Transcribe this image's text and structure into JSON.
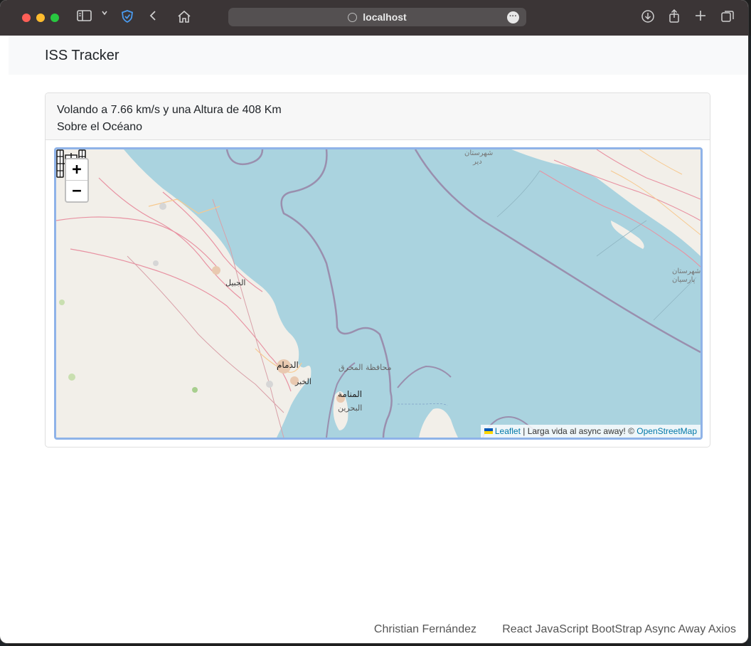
{
  "browser": {
    "url": "localhost"
  },
  "navbar": {
    "brand": "ISS Tracker"
  },
  "card": {
    "status_line": "Volando a 7.66 km/s y una Altura de 408 Km",
    "location_line": "Sobre el Océano"
  },
  "map": {
    "zoom_in": "+",
    "zoom_out": "−",
    "attribution": {
      "leaflet": "Leaflet",
      "middle": " | Larga vida al async away! © ",
      "osm": "OpenStreetMap"
    },
    "labels": {
      "jubail": "الجبيل",
      "dammam": "الدمام",
      "khobar": "الخبر",
      "muharraq": "محافظة المحرق",
      "manama": "المنامة",
      "bahrain": "البحرين",
      "dayyer_1": "شهرستان",
      "dayyer_2": "دیر",
      "parsian_1": "شهرستان",
      "parsian_2": "پارسیان"
    }
  },
  "footer": {
    "author": "Christian Fernández",
    "stack": "React JavaScript BootStrap Async Away Axios"
  }
}
